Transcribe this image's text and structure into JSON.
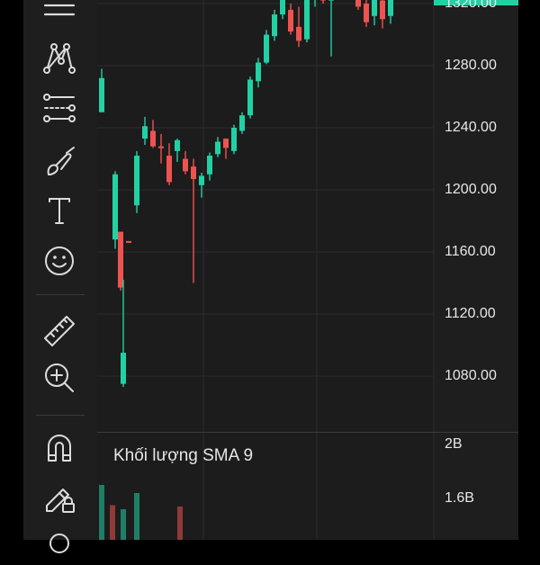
{
  "colors": {
    "up": "#22d1a3",
    "down": "#ef5350",
    "background": "#1c1c1d",
    "grid": "#2c2c2e",
    "text": "#e8e8e8"
  },
  "toolbar": {
    "tools": [
      {
        "name": "trend-line-icon"
      },
      {
        "name": "pattern-icon"
      },
      {
        "name": "fib-retracement-icon"
      },
      {
        "name": "brush-icon"
      },
      {
        "name": "text-icon"
      },
      {
        "name": "emoji-icon"
      },
      {
        "name": "ruler-icon"
      },
      {
        "name": "zoom-in-icon"
      },
      {
        "name": "magnet-icon"
      },
      {
        "name": "lock-drawings-icon"
      },
      {
        "name": "more-icon"
      }
    ]
  },
  "price_axis": {
    "labels": [
      "1320.00",
      "1280.00",
      "1240.00",
      "1200.00",
      "1160.00",
      "1120.00",
      "1080.00"
    ]
  },
  "volume_panel": {
    "title": "Khối lượng SMA 9",
    "labels": [
      "2B",
      "1.6B"
    ]
  },
  "candles": [
    {
      "o": 1250,
      "h": 1278,
      "l": 1250,
      "c": 1272
    },
    {
      "o": 1168,
      "h": 1212,
      "l": 1162,
      "c": 1210
    },
    {
      "o": 1173,
      "h": 1173,
      "l": 1135,
      "c": 1137
    },
    {
      "o": 1075,
      "h": 1142,
      "l": 1073,
      "c": 1095
    },
    {
      "o": 1167,
      "h": 1167,
      "l": 1166,
      "c": 1166
    },
    {
      "o": 1190,
      "h": 1225,
      "l": 1185,
      "c": 1222
    },
    {
      "o": 1233,
      "h": 1247,
      "l": 1229,
      "c": 1241
    },
    {
      "o": 1238,
      "h": 1245,
      "l": 1227,
      "c": 1228
    },
    {
      "o": 1228,
      "h": 1236,
      "l": 1217,
      "c": 1227
    },
    {
      "o": 1222,
      "h": 1230,
      "l": 1203,
      "c": 1205
    },
    {
      "o": 1225,
      "h": 1233,
      "l": 1218,
      "c": 1232
    },
    {
      "o": 1220,
      "h": 1225,
      "l": 1210,
      "c": 1212
    },
    {
      "o": 1215,
      "h": 1220,
      "l": 1140,
      "c": 1207
    },
    {
      "o": 1203,
      "h": 1211,
      "l": 1195,
      "c": 1209
    },
    {
      "o": 1210,
      "h": 1224,
      "l": 1206,
      "c": 1222
    },
    {
      "o": 1223,
      "h": 1234,
      "l": 1221,
      "c": 1231
    },
    {
      "o": 1233,
      "h": 1230,
      "l": 1220,
      "c": 1227
    },
    {
      "o": 1225,
      "h": 1242,
      "l": 1223,
      "c": 1240
    },
    {
      "o": 1238,
      "h": 1250,
      "l": 1236,
      "c": 1248
    },
    {
      "o": 1248,
      "h": 1273,
      "l": 1246,
      "c": 1271
    },
    {
      "o": 1270,
      "h": 1285,
      "l": 1266,
      "c": 1282
    },
    {
      "o": 1282,
      "h": 1303,
      "l": 1281,
      "c": 1300
    },
    {
      "o": 1299,
      "h": 1316,
      "l": 1296,
      "c": 1313
    },
    {
      "o": 1313,
      "h": 1328,
      "l": 1310,
      "c": 1326
    },
    {
      "o": 1316,
      "h": 1320,
      "l": 1300,
      "c": 1302
    },
    {
      "o": 1305,
      "h": 1318,
      "l": 1292,
      "c": 1296
    },
    {
      "o": 1297,
      "h": 1328,
      "l": 1295,
      "c": 1325
    },
    {
      "o": 1325,
      "h": 1338,
      "l": 1318,
      "c": 1330
    },
    {
      "o": 1330,
      "h": 1339,
      "l": 1320,
      "c": 1322
    },
    {
      "o": 1322,
      "h": 1340,
      "l": 1286,
      "c": 1330
    },
    {
      "o": 1330,
      "h": 1345,
      "l": 1325,
      "c": 1340
    },
    {
      "o": 1338,
      "h": 1343,
      "l": 1316,
      "c": 1318
    },
    {
      "o": 1320,
      "h": 1330,
      "l": 1305,
      "c": 1308
    },
    {
      "o": 1312,
      "h": 1330,
      "l": 1306,
      "c": 1326
    },
    {
      "o": 1322,
      "h": 1330,
      "l": 1304,
      "c": 1310
    },
    {
      "o": 1312,
      "h": 1328,
      "l": 1307,
      "c": 1325
    }
  ],
  "candle_slots": [
    0,
    5,
    7,
    8,
    10,
    13,
    16,
    19,
    22,
    25,
    28,
    31,
    34,
    37,
    40,
    43,
    46,
    49,
    52,
    55,
    58,
    61,
    64,
    67,
    70,
    73,
    76,
    79,
    82,
    85,
    92,
    95,
    98,
    101,
    104,
    107
  ],
  "volumes": [
    {
      "v": 1.7,
      "dir": "up"
    },
    {
      "v": 1.55,
      "dir": "down"
    },
    {
      "v": 1.52,
      "dir": "up"
    },
    {
      "v": 1.64,
      "dir": "up"
    },
    {
      "v": 1.54,
      "dir": "down"
    }
  ],
  "volume_slots": [
    0,
    4,
    8,
    13,
    29
  ]
}
